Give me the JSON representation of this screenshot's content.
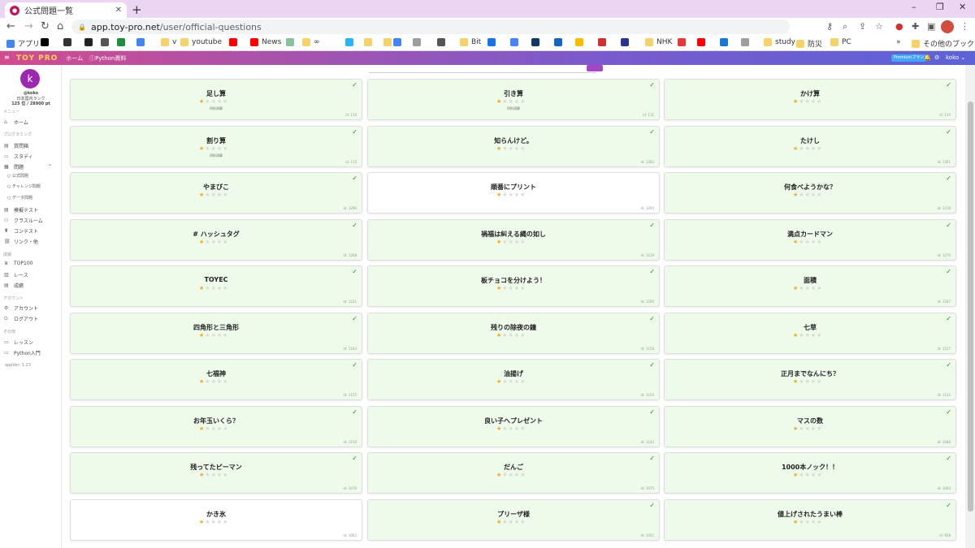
{
  "browser": {
    "tab_title": "公式問題一覧",
    "tab_close": "✕",
    "new_tab": "+",
    "url_domain": "app.toy-pro.net",
    "url_path": "/user/official-questions",
    "win_min": "–",
    "win_max": "❐",
    "win_close": "✕"
  },
  "bookmarks": [
    {
      "label": "アプリ",
      "color": "#4285f4"
    },
    {
      "label": "",
      "color": "#000000"
    },
    {
      "label": "",
      "color": "#333333"
    },
    {
      "label": "",
      "color": "#222222"
    },
    {
      "label": "",
      "color": "#555555"
    },
    {
      "label": "",
      "color": "#1e8e3e"
    },
    {
      "label": "",
      "color": "#4285f4"
    },
    {
      "label": "v",
      "color": "#f6d26b"
    },
    {
      "label": "youtube",
      "color": "#f6d26b"
    },
    {
      "label": "",
      "color": "#ff0000"
    },
    {
      "label": "News",
      "color": "#ff0000"
    },
    {
      "label": "",
      "color": "#88c0a0"
    },
    {
      "label": "∞",
      "color": "#f6d26b"
    },
    {
      "label": "",
      "color": "#29b6f6"
    },
    {
      "label": "",
      "color": "#f6d26b"
    },
    {
      "label": "",
      "color": "#f6d26b"
    },
    {
      "label": "",
      "color": "#4285f4"
    },
    {
      "label": "",
      "color": "#9e9e9e"
    },
    {
      "label": "",
      "color": "#555555"
    },
    {
      "label": "Bit",
      "color": "#f6d26b"
    },
    {
      "label": "",
      "color": "#1a73e8"
    },
    {
      "label": "",
      "color": "#4285f4"
    },
    {
      "label": "",
      "color": "#0d3b66"
    },
    {
      "label": "",
      "color": "#1565c0"
    },
    {
      "label": "",
      "color": "#fbbc04"
    },
    {
      "label": "",
      "color": "#d32f2f"
    },
    {
      "label": "",
      "color": "#283593"
    },
    {
      "label": "NHK",
      "color": "#f6d26b"
    },
    {
      "label": "",
      "color": "#e53935"
    },
    {
      "label": "",
      "color": "#ff0000"
    },
    {
      "label": "",
      "color": "#1976d2"
    },
    {
      "label": "",
      "color": "#9e9e9e"
    },
    {
      "label": "study",
      "color": "#f6d26b"
    },
    {
      "label": "防災",
      "color": "#f6d26b"
    },
    {
      "label": "PC",
      "color": "#f6d26b"
    }
  ],
  "bookmarks_more": "»",
  "bookmarks_other": "その他のブックマーク",
  "header": {
    "logo": "TOY PRO",
    "home": "ホーム",
    "python": "Python資料",
    "premium": "Premiumプラン",
    "user": "koko ⌄"
  },
  "sidebar": {
    "avatar_letter": "k",
    "username": "@koko",
    "rank": "日本国内ランク",
    "score": "125 位 / 28900 pt",
    "section_menu": "メニュー",
    "home": "ホーム",
    "section_programming": "プログラミング",
    "lesson_room": "質問箱",
    "study": "スタディ",
    "problems": "問題",
    "sub_official": "公式問題",
    "sub_challenge": "チャレンジ問題",
    "sub_data": "データ問題",
    "skill_test": "模擬テスト",
    "classroom": "クラスルーム",
    "contest": "コンテスト",
    "links": "リンク・他",
    "section_ranking": "成績",
    "top100": "TOP100",
    "race": "レース",
    "results": "成績",
    "section_account": "アカウント",
    "account": "アカウント",
    "logout": "ログアウト",
    "section_other": "その他",
    "lessons": "レッスン",
    "python_intro": "Python入門",
    "version": "appVer: 1.23"
  },
  "cards": [
    {
      "name": "足し算",
      "stars": 1,
      "tag": "四則演算",
      "id": "id: 110",
      "solved": true
    },
    {
      "name": "引き算",
      "stars": 1,
      "tag": "四則演算",
      "id": "id: 111",
      "solved": true
    },
    {
      "name": "かけ算",
      "stars": 1,
      "tag": "",
      "id": "id: 114",
      "solved": true
    },
    {
      "name": "割り算",
      "stars": 1,
      "tag": "四則演算",
      "id": "id: 115",
      "solved": true
    },
    {
      "name": "知らんけど。",
      "stars": 1,
      "tag": "",
      "id": "id: 1302",
      "solved": true
    },
    {
      "name": "たけし",
      "stars": 1,
      "tag": "",
      "id": "id: 1301",
      "solved": true
    },
    {
      "name": "やまびこ",
      "stars": 1,
      "tag": "",
      "id": "id: 1296",
      "solved": true
    },
    {
      "name": "順番にプリント",
      "stars": 1,
      "tag": "",
      "id": "id: 1295",
      "solved": false
    },
    {
      "name": "何食べようかな？",
      "stars": 1,
      "tag": "",
      "id": "id: 1216",
      "solved": true
    },
    {
      "name": "# ハッシュタグ",
      "stars": 1,
      "tag": "",
      "id": "id: 1268",
      "solved": true
    },
    {
      "name": "禍福は糾える縄の如し",
      "stars": 1,
      "tag": "",
      "id": "id: 1219",
      "solved": true
    },
    {
      "name": "満点カードマン",
      "stars": 1,
      "tag": "",
      "id": "id: 1270",
      "solved": true
    },
    {
      "name": "TOYEC",
      "stars": 1,
      "tag": "",
      "id": "id: 1221",
      "solved": true
    },
    {
      "name": "板チョコを分けよう！",
      "stars": 1,
      "tag": "",
      "id": "id: 1200",
      "solved": true
    },
    {
      "name": "面積",
      "stars": 1,
      "tag": "",
      "id": "id: 1187",
      "solved": true
    },
    {
      "name": "四角形と三角形",
      "stars": 1,
      "tag": "",
      "id": "id: 1164",
      "solved": true
    },
    {
      "name": "残りの除夜の鐘",
      "stars": 1,
      "tag": "",
      "id": "id: 1159",
      "solved": true
    },
    {
      "name": "七草",
      "stars": 1,
      "tag": "",
      "id": "id: 1157",
      "solved": true
    },
    {
      "name": "七福神",
      "stars": 1,
      "tag": "",
      "id": "id: 1155",
      "solved": true
    },
    {
      "name": "油揚げ",
      "stars": 1,
      "tag": "",
      "id": "id: 1154",
      "solved": true
    },
    {
      "name": "正月までなんにち？",
      "stars": 1,
      "tag": "",
      "id": "id: 1153",
      "solved": true
    },
    {
      "name": "お年玉いくら？",
      "stars": 1,
      "tag": "",
      "id": "id: 1150",
      "solved": true
    },
    {
      "name": "良い子へプレゼント",
      "stars": 1,
      "tag": "",
      "id": "id: 1142",
      "solved": true
    },
    {
      "name": "マスの数",
      "stars": 1,
      "tag": "",
      "id": "id: 1080",
      "solved": true
    },
    {
      "name": "残ってたピーマン",
      "stars": 1,
      "tag": "",
      "id": "id: 1079",
      "solved": true
    },
    {
      "name": "だんご",
      "stars": 1,
      "tag": "",
      "id": "id: 1075",
      "solved": true
    },
    {
      "name": "1000本ノック！！",
      "stars": 1,
      "tag": "",
      "id": "id: 1064",
      "solved": true
    },
    {
      "name": "かき氷",
      "stars": 1,
      "tag": "",
      "id": "id: 1063",
      "solved": false
    },
    {
      "name": "プリーザ様",
      "stars": 1,
      "tag": "",
      "id": "id: 1051",
      "solved": true
    },
    {
      "name": "値上げされたうまい棒",
      "stars": 1,
      "tag": "",
      "id": "id: 958",
      "solved": true
    }
  ]
}
